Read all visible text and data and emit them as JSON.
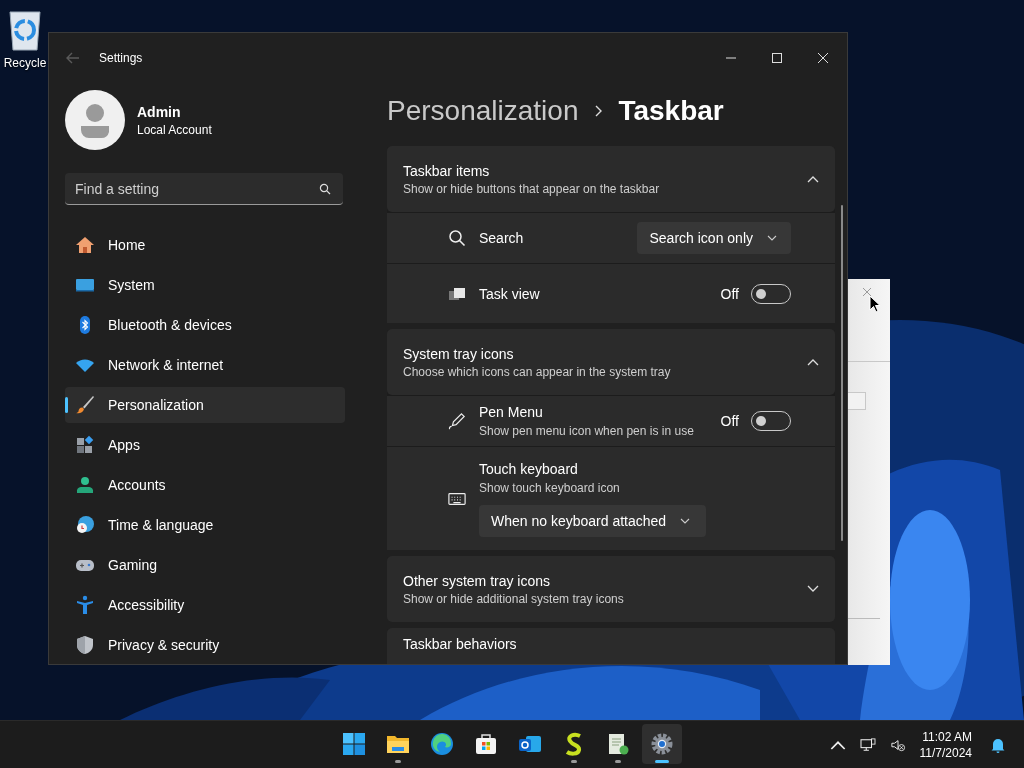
{
  "desktop": {
    "icons": [
      {
        "label": "Recycle"
      }
    ]
  },
  "window": {
    "title": "Settings"
  },
  "account": {
    "name": "Admin",
    "type": "Local Account"
  },
  "search": {
    "placeholder": "Find a setting"
  },
  "nav": [
    {
      "label": "Home",
      "selected": false
    },
    {
      "label": "System",
      "selected": false
    },
    {
      "label": "Bluetooth & devices",
      "selected": false
    },
    {
      "label": "Network & internet",
      "selected": false
    },
    {
      "label": "Personalization",
      "selected": true
    },
    {
      "label": "Apps",
      "selected": false
    },
    {
      "label": "Accounts",
      "selected": false
    },
    {
      "label": "Time & language",
      "selected": false
    },
    {
      "label": "Gaming",
      "selected": false
    },
    {
      "label": "Accessibility",
      "selected": false
    },
    {
      "label": "Privacy & security",
      "selected": false
    }
  ],
  "breadcrumb": {
    "parent": "Personalization",
    "current": "Taskbar"
  },
  "sections": [
    {
      "title": "Taskbar items",
      "subtitle": "Show or hide buttons that appear on the taskbar",
      "expanded": true,
      "rows": [
        {
          "kind": "dropdown",
          "label": "Search",
          "value": "Search icon only"
        },
        {
          "kind": "toggle",
          "label": "Task view",
          "state": "Off",
          "on": false
        }
      ]
    },
    {
      "title": "System tray icons",
      "subtitle": "Choose which icons can appear in the system tray",
      "expanded": true,
      "rows": [
        {
          "kind": "toggle",
          "label": "Pen Menu",
          "description": "Show pen menu icon when pen is in use",
          "state": "Off",
          "on": false
        },
        {
          "kind": "dropdown-below",
          "label": "Touch keyboard",
          "description": "Show touch keyboard icon",
          "value": "When no keyboard attached"
        }
      ]
    },
    {
      "title": "Other system tray icons",
      "subtitle": "Show or hide additional system tray icons",
      "expanded": false
    },
    {
      "title": "Taskbar behaviors"
    }
  ],
  "taskbar": {
    "apps": [
      {
        "running": false,
        "active": false
      },
      {
        "running": true,
        "active": false
      },
      {
        "running": false,
        "active": false
      },
      {
        "running": false,
        "active": false
      },
      {
        "running": false,
        "active": false
      },
      {
        "running": true,
        "active": false
      },
      {
        "running": true,
        "active": false
      },
      {
        "running": true,
        "active": true
      }
    ],
    "time": "11:02 AM",
    "date": "11/7/2024"
  }
}
